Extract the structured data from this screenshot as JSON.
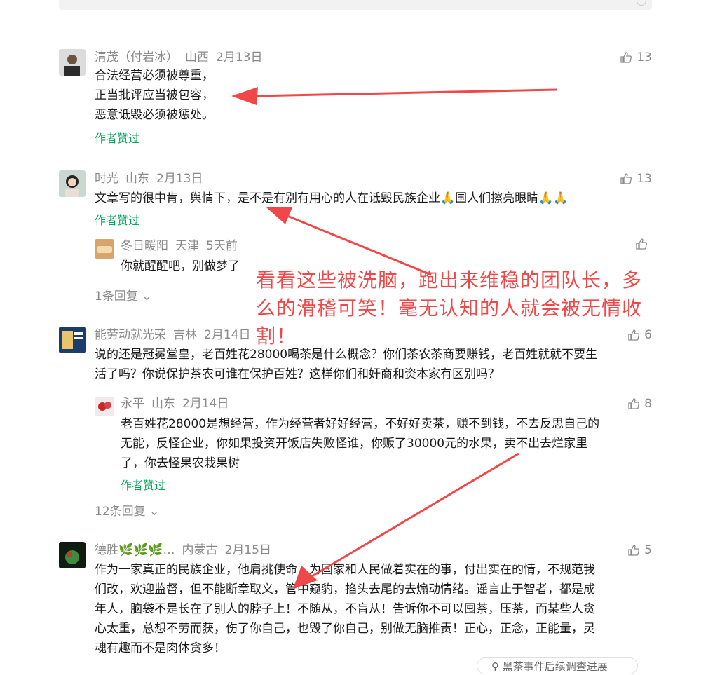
{
  "comments": [
    {
      "name": "清茂（付岩冰）",
      "location": "山西",
      "date": "2月13日",
      "likes": "13",
      "lines": [
        "合法经营必须被尊重，",
        "正当批评应当被包容，",
        "恶意诋毁必须被惩处。"
      ],
      "author_liked": "作者赞过"
    },
    {
      "name": "时光",
      "location": "山东",
      "date": "2月13日",
      "likes": "13",
      "text": "文章写的很中肯，舆情下，是不是有别有用心的人在诋毁民族企业🙏国人们擦亮眼睛🙏🙏",
      "author_liked": "作者赞过",
      "reply": {
        "name": "冬日暖阳",
        "location": "天津",
        "date": "5天前",
        "likes": "",
        "text": "你就醒醒吧，别做梦了"
      },
      "more_replies": "1条回复"
    },
    {
      "name": "能劳动就光荣",
      "location": "吉林",
      "date": "2月14日",
      "likes": "6",
      "lines": [
        "说的还是冠冕堂皇，老百姓花28000喝茶是什么概念？你们茶农茶商要赚钱，老百姓就就不要生",
        "活了吗？你说保护茶农可谁在保护百姓？这样你们和奸商和资本家有区别吗？"
      ],
      "reply": {
        "name": "永平",
        "location": "山东",
        "date": "2月14日",
        "likes": "8",
        "lines": [
          "老百姓花28000是想经营，作为经营者好好经营，不好好卖茶，赚不到钱，不去反思自己的",
          "无能，反怪企业，你如果投资开饭店失败怪谁，你贩了30000元的水果，卖不出去烂家里",
          "了，你去怪果农栽果树"
        ],
        "author_liked": "作者赞过"
      },
      "more_replies": "12条回复"
    },
    {
      "name": "德胜🌿🌿🌿…",
      "location": "内蒙古",
      "date": "2月15日",
      "likes": "5",
      "lines": [
        "作为一家真正的民族企业，他肩挑使命，为国家和人民做着实在的事，付出实在的情，不规范我",
        "们改，欢迎监督，但不能断章取义，管中窥豹，掐头去尾的去煽动情绪。谣言止于智者，都是成",
        "年人，脑袋不是长在了别人的脖子上！不随从，不盲从！告诉你不可以囤茶，压茶，而某些人贪",
        "心太重，总想不劳而获，伤了你自己，也毁了你自己，别做无脑推责！正心，正念，正能量，灵",
        "魂有趣而不是肉体贪多！"
      ]
    }
  ],
  "annotation": [
    "看看这些被洗脑，跑出来维稳的团队长，多",
    "么的滑稽可笑！毫无认知的人就会被无情收",
    "割！"
  ],
  "floating_search": "黑茶事件后续调查进展",
  "colors": {
    "accent_green": "#07a35a",
    "annotation_red": "#f04848",
    "meta_gray": "#8a8a8a"
  }
}
